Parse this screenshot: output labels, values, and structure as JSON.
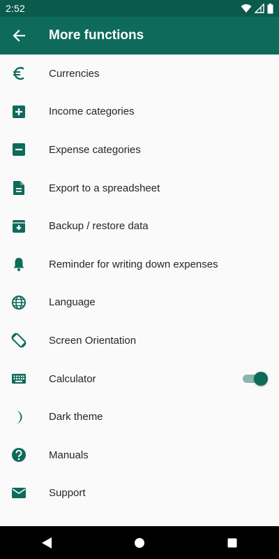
{
  "status_bar": {
    "time": "2:52"
  },
  "app_bar": {
    "title": "More functions"
  },
  "items": [
    {
      "label": "Currencies",
      "icon": "euro-icon"
    },
    {
      "label": "Income categories",
      "icon": "plus-box-icon"
    },
    {
      "label": "Expense categories",
      "icon": "minus-box-icon"
    },
    {
      "label": "Export to a spreadsheet",
      "icon": "document-icon"
    },
    {
      "label": "Backup / restore data",
      "icon": "archive-icon"
    },
    {
      "label": "Reminder for writing down expenses",
      "icon": "bell-icon"
    },
    {
      "label": "Language",
      "icon": "globe-icon"
    },
    {
      "label": "Screen Orientation",
      "icon": "screen-rotation-icon"
    },
    {
      "label": "Calculator",
      "icon": "keyboard-icon",
      "toggle_on": true
    },
    {
      "label": "Dark theme",
      "icon": "moon-icon"
    },
    {
      "label": "Manuals",
      "icon": "help-icon"
    },
    {
      "label": "Support",
      "icon": "mail-icon"
    }
  ],
  "colors": {
    "primary": "#0e6b5b",
    "status_bar": "#0b5b4d",
    "icon": "#0e6b5b",
    "text": "#262626",
    "background": "#fafafa"
  }
}
